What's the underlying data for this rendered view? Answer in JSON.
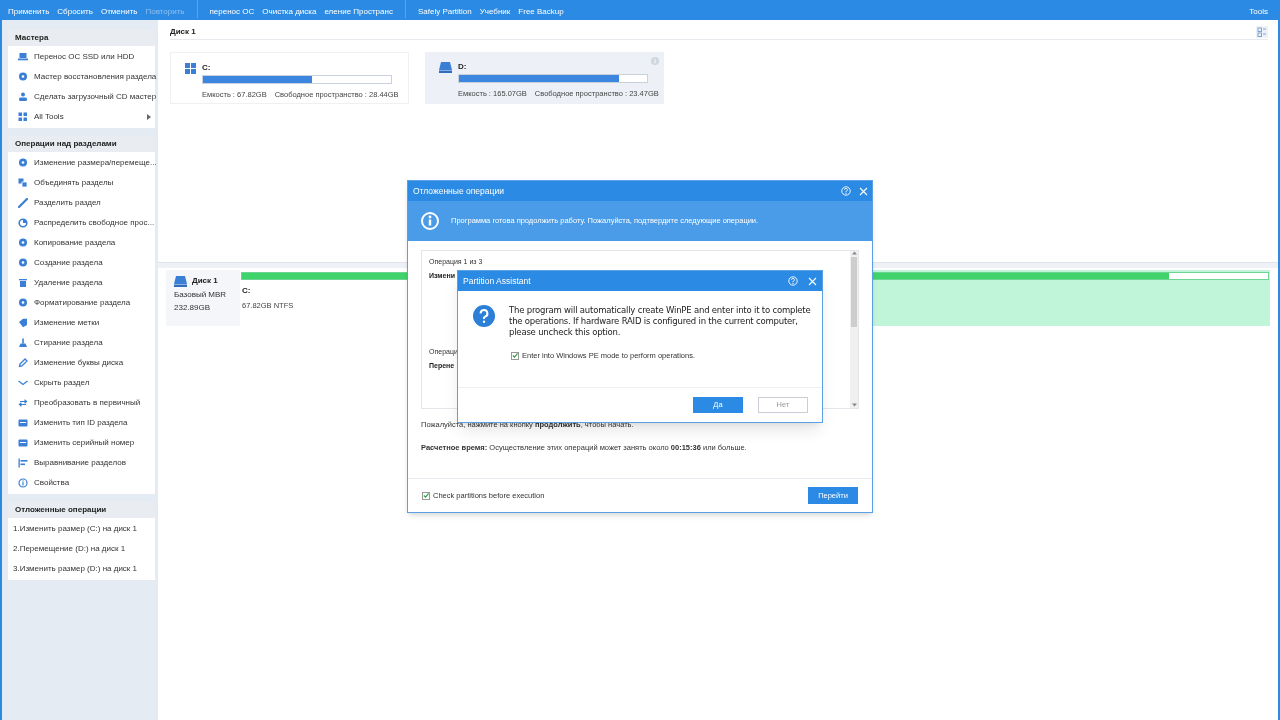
{
  "toolbar": {
    "items": [
      {
        "label": "Применить",
        "disabled": false
      },
      {
        "label": "Сбросить",
        "disabled": false
      },
      {
        "label": "Отменить",
        "disabled": false
      },
      {
        "label": "Повторить",
        "disabled": true
      },
      {
        "label": "перенос ОС",
        "disabled": false
      },
      {
        "label": "Очистка диска",
        "disabled": false
      },
      {
        "label": "еление Пространс",
        "disabled": false
      },
      {
        "label": "Safely Partition",
        "disabled": false
      },
      {
        "label": "Учебник",
        "disabled": false
      },
      {
        "label": "Free Backup",
        "disabled": false
      }
    ],
    "right_item": "Tools"
  },
  "sidebar": {
    "sections": [
      {
        "title": "Мастера",
        "kind": "icons",
        "items": [
          {
            "label": "Перенос ОС SSD или HDD",
            "submenu": false
          },
          {
            "label": "Мастер восстановления раздела",
            "submenu": false
          },
          {
            "label": "Сделать загрузочный CD мастер",
            "submenu": false
          },
          {
            "label": "All Tools",
            "submenu": true
          }
        ]
      },
      {
        "title": "Операции над разделами",
        "kind": "icons",
        "items": [
          {
            "label": "Изменение размера/перемеще...",
            "submenu": false
          },
          {
            "label": "Объединять разделы",
            "submenu": false
          },
          {
            "label": "Разделить раздел",
            "submenu": false
          },
          {
            "label": "Распределить свободное прос...",
            "submenu": false
          },
          {
            "label": "Копирование раздела",
            "submenu": false
          },
          {
            "label": "Создание раздела",
            "submenu": false
          },
          {
            "label": "Удаление раздела",
            "submenu": false
          },
          {
            "label": "Форматирование раздела",
            "submenu": false
          },
          {
            "label": "Изменение метки",
            "submenu": false
          },
          {
            "label": "Стирание раздела",
            "submenu": false
          },
          {
            "label": "Изменение буквы диска",
            "submenu": false
          },
          {
            "label": "Скрыть раздел",
            "submenu": false
          },
          {
            "label": "Преобразовать в первичный",
            "submenu": false
          },
          {
            "label": "Изменить тип ID раздела",
            "submenu": false
          },
          {
            "label": "Изменить серийный номер",
            "submenu": false
          },
          {
            "label": "Выравнивание разделов",
            "submenu": false
          },
          {
            "label": "Свойства",
            "submenu": false
          }
        ]
      },
      {
        "title": "Отложенные операции",
        "kind": "plain",
        "items": [
          {
            "label": "1.Изменить размер (C:) на диск 1",
            "submenu": false
          },
          {
            "label": "2.Перемещение (D:) на диск 1",
            "submenu": false
          },
          {
            "label": "3.Изменить размер (D:) на диск 1",
            "submenu": false
          }
        ]
      }
    ]
  },
  "disk_title": "Диск 1",
  "volumes": [
    {
      "kind": "system",
      "letter": "C:",
      "capacity": "Емкость : 67.82GB",
      "free": "Свободное пространство : 28.44GB",
      "level": 0.58,
      "selected": false
    },
    {
      "kind": "data",
      "letter": "D:",
      "capacity": "Емкость : 165.07GB",
      "free": "Свободное пространство : 23.47GB",
      "level": 0.85,
      "selected": true
    }
  ],
  "disk_map": {
    "name": "Диск 1",
    "type": "Базовый MBR",
    "size": "232.89GB",
    "partitions": [
      {
        "letter": "C:",
        "info": "67.82GB NTFS",
        "level": 1,
        "selected": false
      },
      {
        "level": 0.86,
        "selected": true
      }
    ]
  },
  "pending_dialog": {
    "title": "Отложенные операции",
    "info": "Программа готова продолжить работу. Пожалуйста, подтвердите следующие операции.",
    "operations": [
      {
        "header": "Операция 1 из 3",
        "name": "Измени"
      },
      {
        "header": "Операци",
        "name": "Перене"
      }
    ],
    "prompt": "Пожалуйста, нажмите на кнопку **продолжить**, чтобы начать.",
    "estimate": "**Расчетное время:** Осуществление этих операций может занять около **00:15:36** или больше.",
    "check": {
      "label": "Check partitions before execution",
      "checked": true
    },
    "button": "Перейти"
  },
  "confirm_dialog": {
    "title": "Partition Assistant",
    "message": "The program will automatically create WinPE and enter into it to complete the operations. If hardware RAID is configured in the current computer, please uncheck this option.",
    "check": {
      "label": "Enter into Windows PE mode to perform operations.",
      "checked": true
    },
    "buttons": [
      {
        "label": "Да",
        "default": true
      },
      {
        "label": "Нет",
        "default": false
      }
    ]
  }
}
